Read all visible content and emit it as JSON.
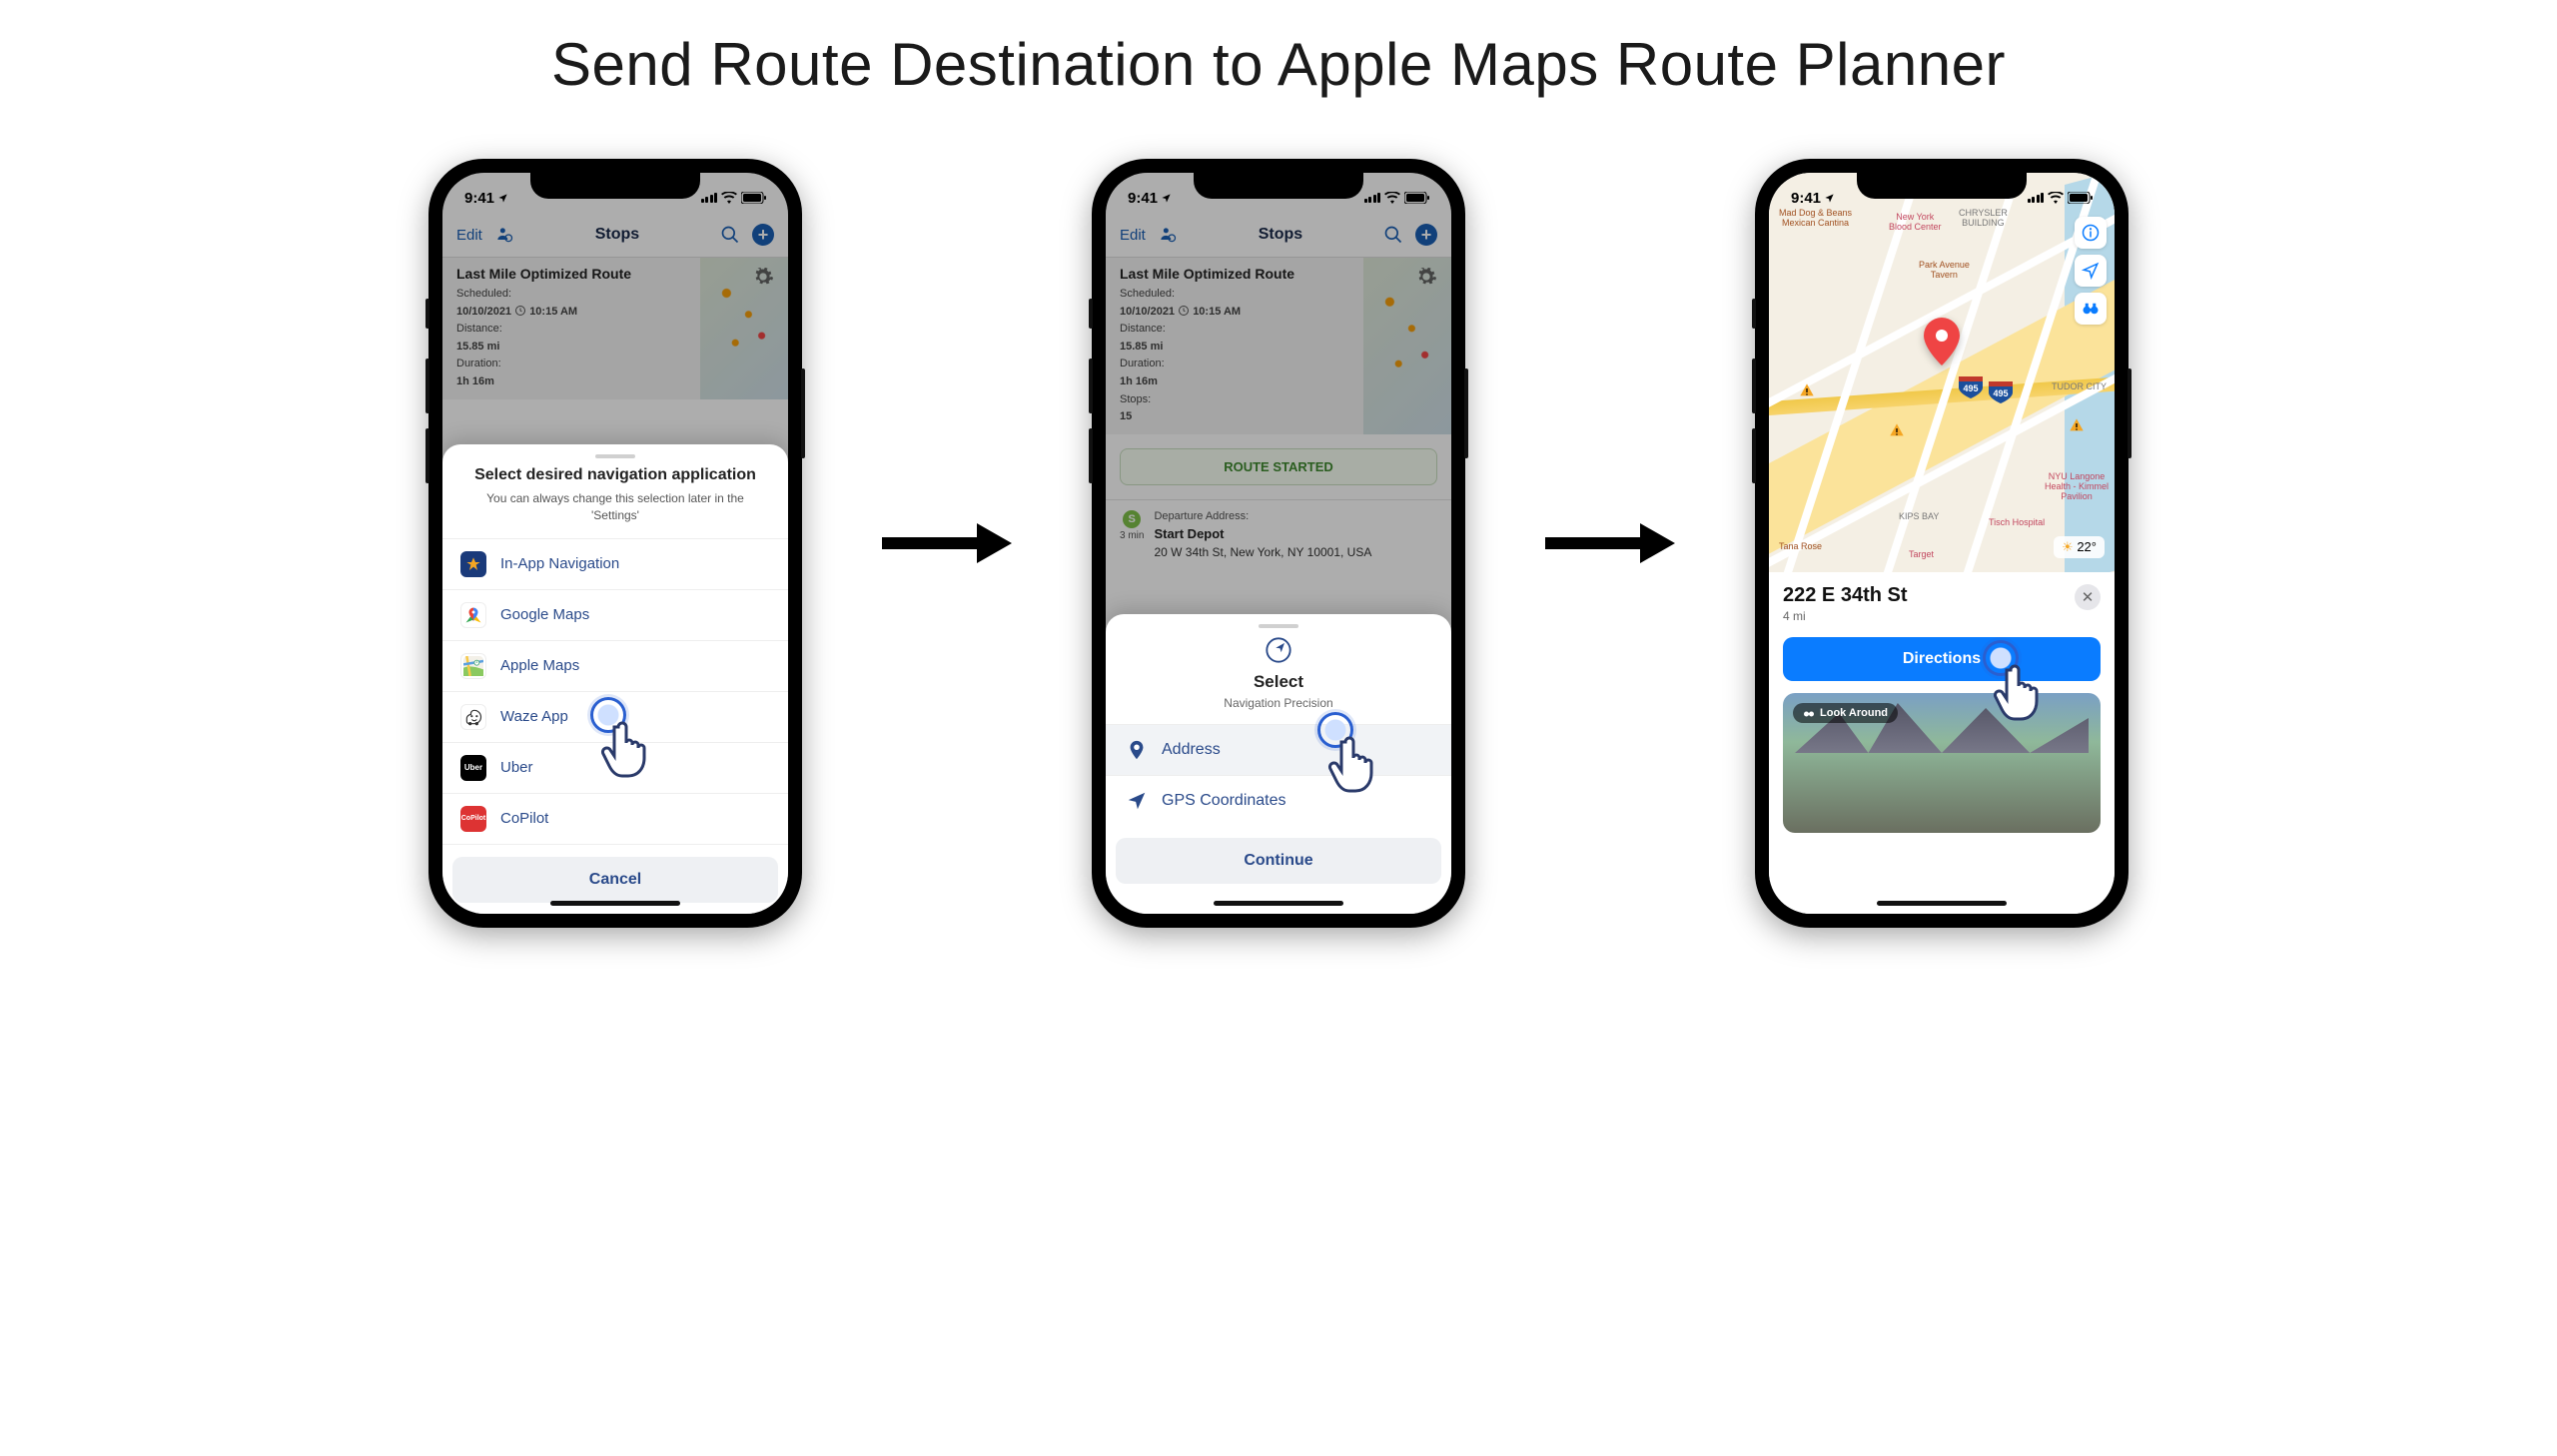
{
  "page_title": "Send Route Destination to Apple Maps Route Planner",
  "status": {
    "time": "9:41"
  },
  "route_screen": {
    "nav": {
      "edit": "Edit",
      "title": "Stops"
    },
    "card": {
      "title": "Last Mile Optimized Route",
      "scheduled_label": "Scheduled:",
      "scheduled_date": "10/10/2021",
      "scheduled_time": "10:15 AM",
      "distance_label": "Distance:",
      "distance_value": "15.85 mi",
      "duration_label": "Duration:",
      "duration_value": "1h 16m",
      "stops_label": "Stops:",
      "stops_value": "15"
    },
    "route_started": "ROUTE STARTED",
    "depot": {
      "badge": "S",
      "eta": "3 min",
      "label": "Departure Address:",
      "title": "Start Depot",
      "address": "20 W 34th St, New York, NY 10001, USA"
    }
  },
  "nav_sheet": {
    "title": "Select desired navigation application",
    "subtitle": "You can always change this selection later in the 'Settings'",
    "items": {
      "inapp": "In-App Navigation",
      "google": "Google Maps",
      "apple": "Apple Maps",
      "waze": "Waze App",
      "uber": "Uber",
      "copilot": "CoPilot"
    },
    "cancel": "Cancel"
  },
  "precision_sheet": {
    "title": "Select",
    "subtitle": "Navigation Precision",
    "address": "Address",
    "gps": "GPS Coordinates",
    "continue": "Continue"
  },
  "apple_maps": {
    "temp": "22°",
    "address": "222 E 34th St",
    "distance": "4 mi",
    "directions": "Directions",
    "look_around": "Look Around",
    "poi": {
      "maddog": "Mad Dog & Beans\nMexican Cantina",
      "nybc": "New York\nBlood Center",
      "chrysler": "CHRYSLER\nBUILDING",
      "park_ave": "Park Avenue\nTavern",
      "tudor": "TUDOR CITY",
      "kips": "KIPS BAY",
      "nyu": "NYU Langone\nHealth - Kimmel\nPavilion",
      "tisch": "Tisch Hospital",
      "target": "Target",
      "tana": "Tana Rose"
    }
  }
}
